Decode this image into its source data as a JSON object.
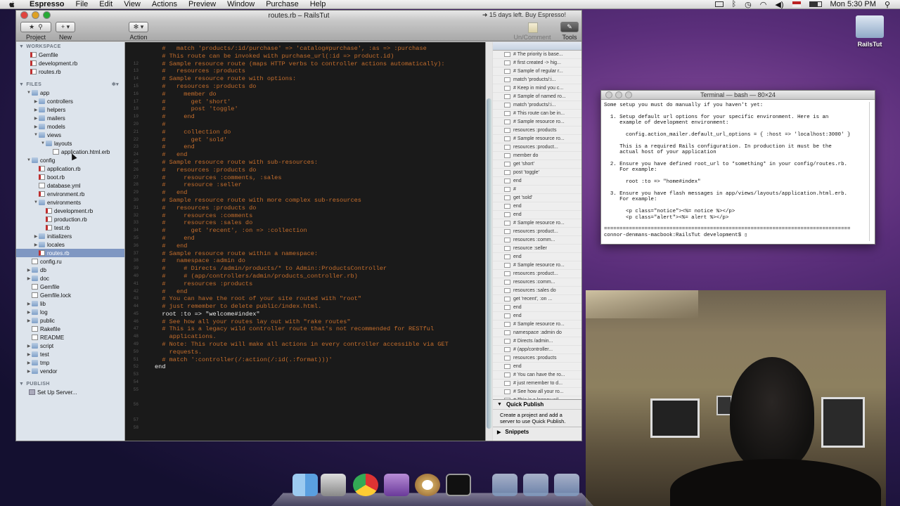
{
  "menubar": {
    "app": "Espresso",
    "items": [
      "File",
      "Edit",
      "View",
      "Actions",
      "Preview",
      "Window",
      "Purchase",
      "Help"
    ],
    "clock": "Mon 5:30 PM"
  },
  "window": {
    "title": "routes.rb – RailsTut",
    "trial": "➜ 15 days left. Buy Espresso!"
  },
  "toolbar": {
    "project": "Project",
    "new": "New",
    "action": "Action",
    "uncomment": "Un/Comment",
    "tools": "Tools"
  },
  "sidebar": {
    "workspace_header": "WORKSPACE",
    "workspace": [
      "Gemfile",
      "development.rb",
      "routes.rb"
    ],
    "files_header": "FILES",
    "tree": [
      {
        "label": "app",
        "level": 1,
        "kind": "folder",
        "open": true
      },
      {
        "label": "controllers",
        "level": 2,
        "kind": "folder"
      },
      {
        "label": "helpers",
        "level": 2,
        "kind": "folder"
      },
      {
        "label": "mailers",
        "level": 2,
        "kind": "folder"
      },
      {
        "label": "models",
        "level": 2,
        "kind": "folder"
      },
      {
        "label": "views",
        "level": 2,
        "kind": "folder",
        "open": true
      },
      {
        "label": "layouts",
        "level": 3,
        "kind": "folder",
        "open": true
      },
      {
        "label": "application.html.erb",
        "level": 4,
        "kind": "file"
      },
      {
        "label": "config",
        "level": 1,
        "kind": "folder",
        "open": true
      },
      {
        "label": "application.rb",
        "level": 2,
        "kind": "rfile"
      },
      {
        "label": "boot.rb",
        "level": 2,
        "kind": "rfile"
      },
      {
        "label": "database.yml",
        "level": 2,
        "kind": "file"
      },
      {
        "label": "environment.rb",
        "level": 2,
        "kind": "rfile"
      },
      {
        "label": "environments",
        "level": 2,
        "kind": "folder",
        "open": true
      },
      {
        "label": "development.rb",
        "level": 3,
        "kind": "rfile"
      },
      {
        "label": "production.rb",
        "level": 3,
        "kind": "rfile"
      },
      {
        "label": "test.rb",
        "level": 3,
        "kind": "rfile"
      },
      {
        "label": "initializers",
        "level": 2,
        "kind": "folder"
      },
      {
        "label": "locales",
        "level": 2,
        "kind": "folder"
      },
      {
        "label": "routes.rb",
        "level": 2,
        "kind": "rfile",
        "selected": true
      },
      {
        "label": "config.ru",
        "level": 1,
        "kind": "file"
      },
      {
        "label": "db",
        "level": 1,
        "kind": "folder"
      },
      {
        "label": "doc",
        "level": 1,
        "kind": "folder"
      },
      {
        "label": "Gemfile",
        "level": 1,
        "kind": "file"
      },
      {
        "label": "Gemfile.lock",
        "level": 1,
        "kind": "file"
      },
      {
        "label": "lib",
        "level": 1,
        "kind": "folder"
      },
      {
        "label": "log",
        "level": 1,
        "kind": "folder"
      },
      {
        "label": "public",
        "level": 1,
        "kind": "folder"
      },
      {
        "label": "Rakefile",
        "level": 1,
        "kind": "file"
      },
      {
        "label": "README",
        "level": 1,
        "kind": "file"
      },
      {
        "label": "script",
        "level": 1,
        "kind": "folder"
      },
      {
        "label": "test",
        "level": 1,
        "kind": "folder"
      },
      {
        "label": "tmp",
        "level": 1,
        "kind": "folder"
      },
      {
        "label": "vendor",
        "level": 1,
        "kind": "folder"
      }
    ],
    "publish_header": "PUBLISH",
    "publish_item": "Set Up Server..."
  },
  "code": [
    "  #   match 'products/:id/purchase' => 'catalog#purchase', :as => :purchase",
    "  # This route can be invoked with purchase_url(:id => product.id)",
    "",
    "  # Sample resource route (maps HTTP verbs to controller actions automatically):",
    "  #   resources :products",
    "",
    "  # Sample resource route with options:",
    "  #   resources :products do",
    "  #     member do",
    "  #       get 'short'",
    "  #       post 'toggle'",
    "  #     end",
    "  #",
    "  #     collection do",
    "  #       get 'sold'",
    "  #     end",
    "  #   end",
    "",
    "  # Sample resource route with sub-resources:",
    "  #   resources :products do",
    "  #     resources :comments, :sales",
    "  #     resource :seller",
    "  #   end",
    "",
    "  # Sample resource route with more complex sub-resources",
    "  #   resources :products do",
    "  #     resources :comments",
    "  #     resources :sales do",
    "  #       get 'recent', :on => :collection",
    "  #     end",
    "  #   end",
    "",
    "  # Sample resource route within a namespace:",
    "  #   namespace :admin do",
    "  #     # Directs /admin/products/* to Admin::ProductsController",
    "  #     # (app/controllers/admin/products_controller.rb)",
    "  #     resources :products",
    "  #   end",
    "",
    "  # You can have the root of your site routed with \"root\"",
    "  # just remember to delete public/index.html.",
    "  root :to => \"welcome#index\"",
    "",
    "  # See how all your routes lay out with \"rake routes\"",
    "",
    "  # This is a legacy wild controller route that's not recommended for RESTful",
    "    applications.",
    "  # Note: This route will make all actions in every controller accessible via GET",
    "    requests.",
    "  # match ':controller(/:action(/:id(.:format)))'",
    "end"
  ],
  "line_numbers": [
    "",
    "",
    "12",
    "13",
    "14",
    "15",
    "16",
    "17",
    "18",
    "19",
    "20",
    "21",
    "22",
    "23",
    "24",
    "25",
    "26",
    "27",
    "28",
    "29",
    "30",
    "31",
    "32",
    "33",
    "34",
    "35",
    "36",
    "37",
    "38",
    "39",
    "40",
    "41",
    "42",
    "43",
    "44",
    "45",
    "46",
    "47",
    "48",
    "49",
    "50",
    "51",
    "52",
    "53",
    "54",
    "55",
    "",
    "56",
    "",
    "57",
    "58"
  ],
  "navigator": [
    "# The priority is base...",
    "# first created -> hig...",
    "# Sample of regular r...",
    "  match 'products/:i...",
    "# Keep in mind you c...",
    "# Sample of named ro...",
    "  match 'products/:i...",
    "# This route can be in...",
    "# Sample resource ro...",
    "  resources :products",
    "# Sample resource ro...",
    "  resources :product...",
    "    member do",
    "      get 'short'",
    "      post 'toggle'",
    "    end",
    "#",
    "      get 'sold'",
    "    end",
    "  end",
    "# Sample resource ro...",
    "  resources :product...",
    "    resources :comm...",
    "    resource :seller",
    "  end",
    "# Sample resource ro...",
    "  resources :product...",
    "    resources :comm...",
    "    resources :sales do",
    "      get 'recent', :on ...",
    "    end",
    "  end",
    "# Sample resource ro...",
    "  namespace :admin do",
    "    # Directs /admin...",
    "    # (app/controller...",
    "    resources :products",
    "  end",
    "# You can have the ro...",
    "# just remember to d...",
    "# See how all your ro...",
    "# This is a legacy wil..."
  ],
  "quick_publish": {
    "title": "Quick Publish",
    "text": "Create a project and add a server to use Quick Publish.",
    "snippets": "Snippets"
  },
  "terminal": {
    "title": "Terminal — bash — 80×24",
    "lines": [
      "Some setup you must do manually if you haven't yet:",
      "",
      "  1. Setup default url options for your specific environment. Here is an",
      "     example of development environment:",
      "",
      "       config.action_mailer.default_url_options = { :host => 'localhost:3000' }",
      "",
      "     This is a required Rails configuration. In production it must be the",
      "     actual host of your application",
      "",
      "  2. Ensure you have defined root_url to *something* in your config/routes.rb.",
      "     For example:",
      "",
      "       root :to => \"home#index\"",
      "",
      "  3. Ensure you have flash messages in app/views/layouts/application.html.erb.",
      "     For example:",
      "",
      "       <p class=\"notice\"><%= notice %></p>",
      "       <p class=\"alert\"><%= alert %></p>",
      "",
      "===============================================================================",
      "connor-denmans-macbook:RailsTut development$ ▯"
    ]
  },
  "desktop": {
    "folder_label": "RailsTut"
  },
  "colors": {
    "editor_bg": "#1a1a1a",
    "comment": "#c56e2c",
    "sidebar": "#dde4ec",
    "selection": "#7f97c2"
  }
}
